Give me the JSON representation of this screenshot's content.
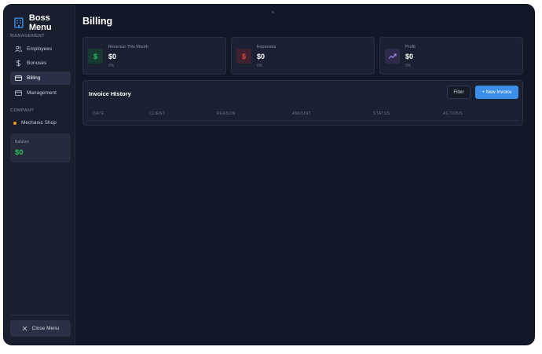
{
  "sidebar": {
    "brand_title": "Boss Menu",
    "sections": {
      "management": "MANAGEMENT",
      "company": "COMPANY"
    },
    "items": [
      {
        "label": "Employees",
        "icon": "users-icon",
        "active": false
      },
      {
        "label": "Bonuses",
        "icon": "dollar-icon",
        "active": false
      },
      {
        "label": "Billing",
        "icon": "credit-card-icon",
        "active": true
      },
      {
        "label": "Management",
        "icon": "credit-card-icon",
        "active": false
      }
    ],
    "company_name": "Mechanic Shop",
    "balance_label": "Balance",
    "balance_value": "$0",
    "close_label": "Close Menu"
  },
  "main": {
    "title": "Billing",
    "stats": [
      {
        "label": "Revenue This Month",
        "value": "$0",
        "change": "0%",
        "icon": "$",
        "color": "#22c55e",
        "bg": "#173a33"
      },
      {
        "label": "Expenses",
        "value": "$0",
        "change": "0%",
        "icon": "$",
        "color": "#ef4444",
        "bg": "#3f2230"
      },
      {
        "label": "Profit",
        "value": "$0",
        "change": "0%",
        "icon": "trend-up-icon",
        "color": "#a78bfa",
        "bg": "#2e2a4a"
      }
    ],
    "invoices": {
      "title": "Invoice History",
      "filter_label": "Filter",
      "new_label": "+ New Invoice",
      "columns": [
        "DATE",
        "CLIENT",
        "REASON",
        "AMOUNT",
        "STATUS",
        "ACTIONS"
      ]
    }
  },
  "colors": {
    "accent": "#3b8fe8",
    "success": "#22c55e",
    "danger": "#ef4444",
    "company_dot": "#f59e0b"
  }
}
